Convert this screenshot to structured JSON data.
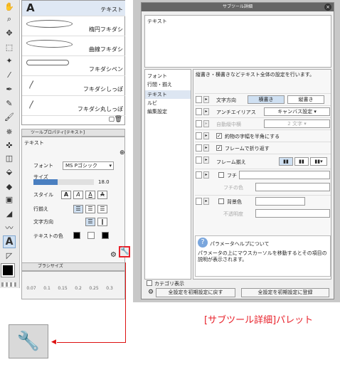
{
  "tool_list": [
    {
      "label": "テキスト",
      "selected": true
    },
    {
      "label": "楕円フキダシ"
    },
    {
      "label": "曲線フキダシ"
    },
    {
      "label": "フキダシペン"
    },
    {
      "label": "フキダシしっぽ"
    },
    {
      "label": "フキダシ丸しっぽ"
    }
  ],
  "tool_property": {
    "header": "ツールプロパティ[テキスト]",
    "tool_name": "テキスト",
    "font_label": "フォント",
    "font_value": "MS Pゴシック",
    "size_label": "サイズ",
    "size_value": "18.0",
    "style_label": "スタイル",
    "align_label": "行揃え",
    "direction_label": "文字方向",
    "color_label": "テキストの色"
  },
  "brush_size": {
    "header": "ブラシサイズ",
    "sizes": [
      "0.07",
      "0.1",
      "0.15",
      "0.2",
      "0.25",
      "0.3"
    ]
  },
  "subtool_dialog": {
    "title": "サブツール詳細",
    "preview_text": "テキスト",
    "categories": [
      "フォント",
      "行間・揃え",
      "テキスト",
      "ルビ",
      "編集設定"
    ],
    "description": "縦書き・横書きなどテキスト全体の設定を行います。",
    "settings": {
      "direction_label": "文字方向",
      "horizontal_label": "横書き",
      "vertical_label": "縦書き",
      "antialias_label": "アンチエイリアス",
      "antialias_value": "キャンバス設定",
      "auto_tcy_label": "自動縦中横",
      "auto_tcy_value": "2 文字",
      "halfwidth_label": "約物の字幅を半角にする",
      "wrap_label": "フレームで折り返す",
      "frame_align_label": "フレーム揃え",
      "edge_label": "フチ",
      "edge_color_label": "フチの色",
      "bg_label": "背景色",
      "opacity_label": "不透明度"
    },
    "help_title": "パラメータヘルプについて",
    "help_text": "パラメータの上にマウスカーソルを移動するとその項目の説明が表示されます。",
    "category_display": "カテゴリ表示",
    "reset_btn": "全設定を初期設定に戻す",
    "register_btn": "全設定を初期設定に登録"
  },
  "caption": "[サブツール詳細]パレット",
  "colors": {
    "accent": "#e8222b",
    "dialog_title_bg": "#666666"
  },
  "icons": [
    "wrench-icon",
    "text-tool-icon"
  ]
}
